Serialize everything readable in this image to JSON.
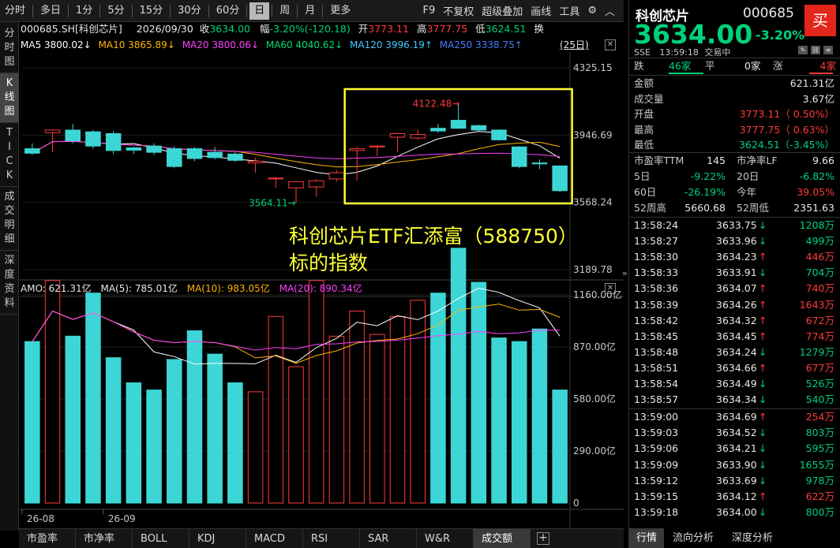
{
  "toolbar": {
    "periods": [
      "分时",
      "多日",
      "1分",
      "5分",
      "15分",
      "30分",
      "60分",
      "日",
      "周",
      "月",
      "更多"
    ],
    "active_period": "日",
    "right_tools": [
      "F9",
      "不复权",
      "超级叠加",
      "画线",
      "工具"
    ],
    "settings_icon": "gear-icon",
    "collapse_icon": "chevron-up-icon"
  },
  "leftnav": [
    {
      "label": "分时图",
      "active": false
    },
    {
      "label": "K线图",
      "active": true
    },
    {
      "label": "TICK",
      "active": false
    },
    {
      "label": "成交明细",
      "active": false
    },
    {
      "label": "深度资料",
      "active": false
    }
  ],
  "info": {
    "code_name": "000685.SH[科创芯片]",
    "date": "2026/09/30",
    "close_label": "收",
    "close": "3634.00",
    "change_label": "幅",
    "change": "-3.20%(-120.18)",
    "open_label": "开",
    "open": "3773.11",
    "high_label": "高",
    "high": "3777.75",
    "low_label": "低",
    "low": "3624.51",
    "swap_label": "换"
  },
  "ma": {
    "ma5": "MA5 3800.02↓",
    "ma10": "MA10 3865.89↓",
    "ma20": "MA20 3800.06↓",
    "ma60": "MA60 4040.62↓",
    "ma120": "MA120 3996.19↑",
    "ma250": "MA250 3338.75↑",
    "count": "(25日)"
  },
  "amo": {
    "amo": "AMO: 621.31亿",
    "ma5": "MA(5): 785.01亿",
    "ma10": "MA(10): 983.05亿",
    "ma20": "MA(20): 890.34亿"
  },
  "chart_data": {
    "type": "candlestick",
    "price_axis": {
      "ticks": [
        "4325.15",
        "3946.69",
        "3568.24",
        "3189.78"
      ],
      "ylim": [
        3189.78,
        4325.15
      ]
    },
    "volume_axis": {
      "ticks": [
        "1160.00亿",
        "870.00亿",
        "580.00亿",
        "290.00亿",
        "0"
      ],
      "ylim": [
        0,
        1160
      ]
    },
    "x_labels": [
      {
        "label": "26-08",
        "index": 0
      },
      {
        "label": "26-09",
        "index": 4
      }
    ],
    "candles": [
      {
        "o": 3870,
        "h": 3900,
        "l": 3835,
        "c": 3845
      },
      {
        "o": 3960,
        "h": 3980,
        "l": 3850,
        "c": 3975
      },
      {
        "o": 3975,
        "h": 4010,
        "l": 3900,
        "c": 3915
      },
      {
        "o": 3965,
        "h": 3975,
        "l": 3870,
        "c": 3885
      },
      {
        "o": 3955,
        "h": 3970,
        "l": 3840,
        "c": 3860
      },
      {
        "o": 3875,
        "h": 3880,
        "l": 3840,
        "c": 3862
      },
      {
        "o": 3885,
        "h": 3900,
        "l": 3835,
        "c": 3850
      },
      {
        "o": 3870,
        "h": 3885,
        "l": 3760,
        "c": 3770
      },
      {
        "o": 3870,
        "h": 3880,
        "l": 3800,
        "c": 3815
      },
      {
        "o": 3850,
        "h": 3880,
        "l": 3810,
        "c": 3820
      },
      {
        "o": 3840,
        "h": 3850,
        "l": 3795,
        "c": 3805
      },
      {
        "o": 3790,
        "h": 3820,
        "l": 3735,
        "c": 3800
      },
      {
        "o": 3700,
        "h": 3710,
        "l": 3650,
        "c": 3705
      },
      {
        "o": 3650,
        "h": 3690,
        "l": 3565,
        "c": 3685
      },
      {
        "o": 3655,
        "h": 3700,
        "l": 3600,
        "c": 3690
      },
      {
        "o": 3700,
        "h": 3750,
        "l": 3685,
        "c": 3735
      },
      {
        "o": 3860,
        "h": 3880,
        "l": 3690,
        "c": 3870
      },
      {
        "o": 3880,
        "h": 3890,
        "l": 3830,
        "c": 3885
      },
      {
        "o": 3935,
        "h": 3960,
        "l": 3850,
        "c": 3955
      },
      {
        "o": 3930,
        "h": 3980,
        "l": 3920,
        "c": 3950
      },
      {
        "o": 3985,
        "h": 4010,
        "l": 3960,
        "c": 3970
      },
      {
        "o": 4030,
        "h": 4122.48,
        "l": 3985,
        "c": 3985
      },
      {
        "o": 4000,
        "h": 4005,
        "l": 3970,
        "c": 3975
      },
      {
        "o": 3975,
        "h": 3980,
        "l": 3915,
        "c": 3920
      },
      {
        "o": 3880,
        "h": 3885,
        "l": 3760,
        "c": 3770
      },
      {
        "o": 3790,
        "h": 3810,
        "l": 3755,
        "c": 3785
      },
      {
        "o": 3773.11,
        "h": 3777.75,
        "l": 3624.51,
        "c": 3634.0
      }
    ],
    "volumes": [
      900,
      1240,
      930,
      1170,
      810,
      670,
      630,
      800,
      960,
      830,
      670,
      620,
      1040,
      760,
      1240,
      930,
      1070,
      940,
      1040,
      1130,
      1170,
      1420,
      1230,
      920,
      900,
      970,
      630
    ],
    "high_annotation": "4122.48",
    "low_annotation": "3564.11"
  },
  "annotation": {
    "line1": "科创芯片ETF汇添富（588750）",
    "line2": "标的指数"
  },
  "bottom_tabs": [
    "市盈率",
    "市净率",
    "BOLL",
    "KDJ",
    "MACD",
    "RSI",
    "SAR",
    "W&R",
    "成交额"
  ],
  "bottom_active": "成交额",
  "quote": {
    "name": "科创芯片",
    "code": "000685",
    "buy_label": "买",
    "price": "3634.00",
    "change": "-3.20%",
    "exchange": "SSE",
    "time": "13:59:18",
    "status": "交易中",
    "fall_label": "跌",
    "fall_count": "46家",
    "flat_label": "平",
    "flat_count": "0家",
    "rise_label": "涨",
    "rise_count": "4家",
    "rows": [
      {
        "label": "金额",
        "value": "621.31亿",
        "color": "#e8e8e8"
      },
      {
        "label": "成交量",
        "value": "3.67亿",
        "color": "#e8e8e8"
      },
      {
        "label": "开盘",
        "value": "3773.11（ 0.50%）",
        "color": "#ff3b3b"
      },
      {
        "label": "最高",
        "value": "3777.75（ 0.63%）",
        "color": "#ff3b3b"
      },
      {
        "label": "最低",
        "value": "3624.51（-3.45%）",
        "color": "#00d27a"
      }
    ],
    "stats": [
      {
        "l1": "市盈率TTM",
        "v1": "145",
        "c1": "#e8e8e8",
        "l2": "市净率LF",
        "v2": "9.66",
        "c2": "#e8e8e8"
      },
      {
        "l1": "5日",
        "v1": "-9.22%",
        "c1": "#00d27a",
        "l2": "20日",
        "v2": "-6.82%",
        "c2": "#00d27a"
      },
      {
        "l1": "60日",
        "v1": "-26.19%",
        "c1": "#00d27a",
        "l2": "今年",
        "v2": "39.05%",
        "c2": "#ff3b3b"
      },
      {
        "l1": "52周高",
        "v1": "5660.68",
        "c1": "#e8e8e8",
        "l2": "52周低",
        "v2": "2351.63",
        "c2": "#e8e8e8"
      }
    ],
    "ticks": [
      {
        "t": "13:58:24",
        "p": "3633.75",
        "d": "down",
        "v": "1208万"
      },
      {
        "t": "13:58:27",
        "p": "3633.96",
        "d": "down",
        "v": "499万"
      },
      {
        "t": "13:58:30",
        "p": "3634.23",
        "d": "up",
        "v": "446万"
      },
      {
        "t": "13:58:33",
        "p": "3633.91",
        "d": "down",
        "v": "704万"
      },
      {
        "t": "13:58:36",
        "p": "3634.07",
        "d": "up",
        "v": "740万"
      },
      {
        "t": "13:58:39",
        "p": "3634.26",
        "d": "up",
        "v": "1643万"
      },
      {
        "t": "13:58:42",
        "p": "3634.32",
        "d": "up",
        "v": "672万"
      },
      {
        "t": "13:58:45",
        "p": "3634.45",
        "d": "up",
        "v": "774万"
      },
      {
        "t": "13:58:48",
        "p": "3634.24",
        "d": "down",
        "v": "1279万"
      },
      {
        "t": "13:58:51",
        "p": "3634.66",
        "d": "up",
        "v": "677万"
      },
      {
        "t": "13:58:54",
        "p": "3634.49",
        "d": "down",
        "v": "526万"
      },
      {
        "t": "13:58:57",
        "p": "3634.34",
        "d": "down",
        "v": "540万"
      },
      {
        "t": "13:59:00",
        "p": "3634.69",
        "d": "up",
        "v": "254万"
      },
      {
        "t": "13:59:03",
        "p": "3634.52",
        "d": "down",
        "v": "803万"
      },
      {
        "t": "13:59:06",
        "p": "3634.21",
        "d": "down",
        "v": "595万"
      },
      {
        "t": "13:59:09",
        "p": "3633.90",
        "d": "down",
        "v": "1655万"
      },
      {
        "t": "13:59:12",
        "p": "3633.69",
        "d": "down",
        "v": "978万"
      },
      {
        "t": "13:59:15",
        "p": "3634.12",
        "d": "up",
        "v": "622万"
      },
      {
        "t": "13:59:18",
        "p": "3634.00",
        "d": "down",
        "v": "800万"
      }
    ],
    "bottom_tabs": [
      "行情",
      "流向分析",
      "深度分析"
    ],
    "bottom_active": "行情"
  },
  "colors": {
    "up": "#ff3b3b",
    "down": "#00d27a",
    "candle_down_fill": "#3dd6d6",
    "annotation": "#ffff33"
  }
}
